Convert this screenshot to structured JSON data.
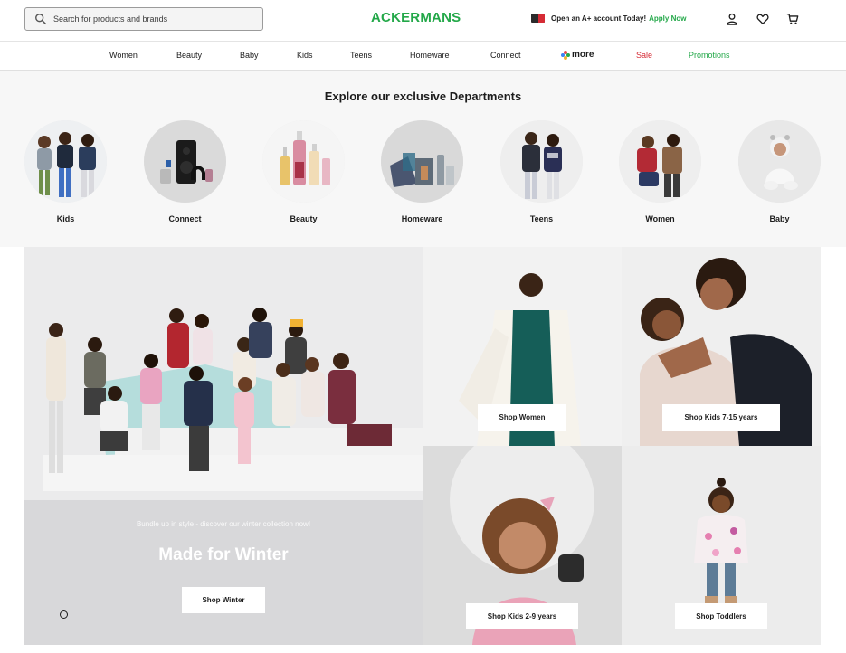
{
  "header": {
    "search_placeholder": "Search for products and brands",
    "logo": "ACKERMANS",
    "promo_text": "Open an A+ account Today!",
    "promo_link": "Apply Now",
    "icons": [
      "search-icon",
      "account-icon",
      "wishlist-heart-icon",
      "cart-icon"
    ]
  },
  "nav": {
    "items": [
      "Women",
      "Beauty",
      "Baby",
      "Kids",
      "Teens",
      "Homeware",
      "Connect"
    ],
    "more": "more",
    "sale": "Sale",
    "promotions": "Promotions"
  },
  "departments": {
    "title": "Explore our exclusive Departments",
    "items": [
      {
        "label": "Kids"
      },
      {
        "label": "Connect"
      },
      {
        "label": "Beauty"
      },
      {
        "label": "Homeware"
      },
      {
        "label": "Teens"
      },
      {
        "label": "Women"
      },
      {
        "label": "Baby"
      }
    ]
  },
  "hero": {
    "subtitle": "Bundle up in style - discover our winter collection now!",
    "title": "Made for Winter",
    "button": "Shop Winter"
  },
  "tiles": {
    "women": "Shop Women",
    "kids_7_15": "Shop Kids 7-15 years",
    "kids_2_9": "Shop Kids 2-9 years",
    "toddlers": "Shop Toddlers"
  },
  "colors": {
    "brand_green": "#23a849",
    "sale_red": "#d62b35",
    "text": "#1c1c1c"
  }
}
